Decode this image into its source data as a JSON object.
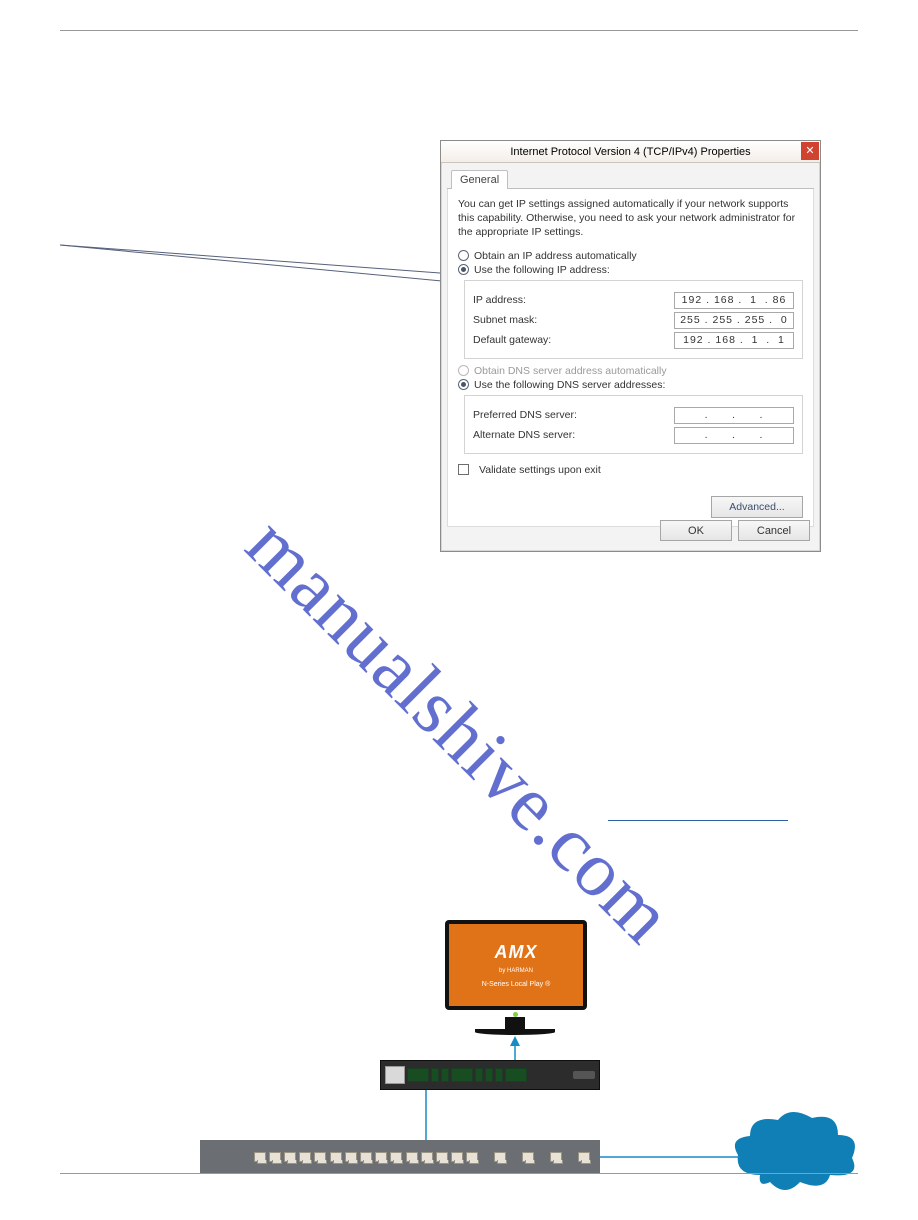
{
  "dialog": {
    "title": "Internet Protocol Version 4 (TCP/IPv4) Properties",
    "tab": "General",
    "intro": "You can get IP settings assigned automatically if your network supports this capability. Otherwise, you need to ask your network administrator for the appropriate IP settings.",
    "radio_auto": "Obtain an IP address automatically",
    "radio_manual": "Use the following IP address:",
    "ip_label": "IP address:",
    "ip_value": "192 . 168 .  1  . 86",
    "subnet_label": "Subnet mask:",
    "subnet_value": "255 . 255 . 255 .  0",
    "gateway_label": "Default gateway:",
    "gateway_value": "192 . 168 .  1  .  1",
    "dns_auto": "Obtain DNS server address automatically",
    "dns_manual": "Use the following DNS server addresses:",
    "pref_dns_label": "Preferred DNS server:",
    "pref_dns_value": ".      .      .",
    "alt_dns_label": "Alternate DNS server:",
    "alt_dns_value": ".      .      .",
    "validate": "Validate settings upon exit",
    "advanced": "Advanced...",
    "ok": "OK",
    "cancel": "Cancel"
  },
  "monitor": {
    "brand": "AMX",
    "sub1": "by HARMAN",
    "sub2": "N-Series Local Play ®"
  },
  "watermark": "manualshive.com"
}
